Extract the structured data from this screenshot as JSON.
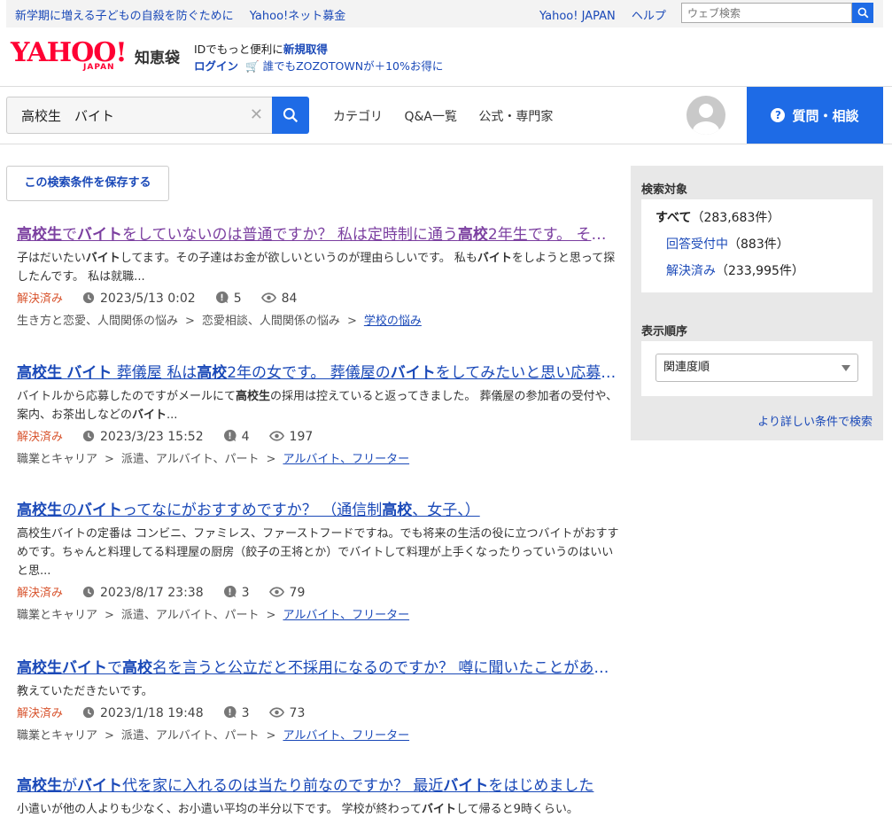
{
  "topbar": {
    "promo": [
      "新学期に増える子どもの自殺を防ぐために",
      "Yahoo!ネット募金"
    ],
    "links": [
      "Yahoo! JAPAN",
      "ヘルプ"
    ],
    "search_placeholder": "ウェブ検索"
  },
  "logo": {
    "yahoo": "YAHOO!",
    "japan": "JAPAN",
    "service": "知恵袋"
  },
  "account": {
    "line1_prefix": "IDでもっと便利に",
    "signup": "新規取得",
    "login": "ログイン",
    "zozo": "誰でもZOZOTOWNが＋10%お得に"
  },
  "search": {
    "query": "高校生　バイト"
  },
  "nav": [
    "カテゴリ",
    "Q&A一覧",
    "公式・専門家"
  ],
  "ask_button": "質問・相談",
  "save_button": "この検索条件を保存する",
  "results": [
    {
      "title_html": "<b>高校生</b>で<b>バイト</b>をしていないのは普通ですか？ 私は定時制に通う<b>高校</b>2年生です。 そして周りの子はみんなバイトしてます",
      "visited": true,
      "snippet_html": "子はだいたい<b>バイト</b>してます。その子達はお金が欲しいというのが理由らしいです。 私も<b>バイト</b>をしようと思って探したんです。 私は就職...",
      "status": "解決済み",
      "date": "2023/5/13 0:02",
      "answers": "5",
      "views": "84",
      "crumbs": [
        "生き方と恋愛、人間関係の悩み",
        "恋愛相談、人間関係の悩み",
        "学校の悩み"
      ]
    },
    {
      "title_html": "<b>高校生</b> <b>バイト</b> 葬儀屋 私は<b>高校</b>2年の女です。 葬儀屋の<b>バイト</b>をしてみたいと思い応募しました",
      "visited": false,
      "snippet_html": "バイトルから応募したのですがメールにて<b>高校生</b>の採用は控えていると返ってきました。 葬儀屋の参加者の受付や、案内、お茶出しなどの<b>バイト</b>...",
      "status": "解決済み",
      "date": "2023/3/23 15:52",
      "answers": "4",
      "views": "197",
      "crumbs": [
        "職業とキャリア",
        "派遣、アルバイト、パート",
        "アルバイト、フリーター"
      ]
    },
    {
      "title_html": "<b>高校生</b>の<b>バイト</b>ってなにがおすすめですか？ （通信制<b>高校</b>、女子、）",
      "visited": false,
      "snippet_html": "高校生バイトの定番は コンビニ、ファミレス、ファーストフードですね。でも将来の生活の役に立つバイトがおすすめです。ちゃんと料理してる料理屋の厨房（餃子の王将とか）でバイトして料理が上手くなったりっていうのはいいと思...",
      "status": "解決済み",
      "date": "2023/8/17 23:38",
      "answers": "3",
      "views": "79",
      "crumbs": [
        "職業とキャリア",
        "派遣、アルバイト、パート",
        "アルバイト、フリーター"
      ]
    },
    {
      "title_html": "<b>高校生バイト</b>で<b>高校</b>名を言うと公立だと不採用になるのですか？ 噂に聞いたことがあるのですが本当ですか",
      "visited": false,
      "snippet_html": "教えていただきたいです。",
      "status": "解決済み",
      "date": "2023/1/18 19:48",
      "answers": "3",
      "views": "73",
      "crumbs": [
        "職業とキャリア",
        "派遣、アルバイト、パート",
        "アルバイト、フリーター"
      ]
    },
    {
      "title_html": "<b>高校生</b>が<b>バイト</b>代を家に入れるのは当たり前なのですか？ 最近<b>バイト</b>をはじめました",
      "visited": false,
      "snippet_html": "小遣いが他の人よりも少なく、お小遣い平均の半分以下です。 学校が終わって<b>バイト</b>して帰ると9時くらい。",
      "status": "",
      "date": "",
      "answers": "",
      "views": "",
      "crumbs": []
    }
  ],
  "sidebar": {
    "target_heading": "検索対象",
    "targets": [
      {
        "label": "すべて",
        "count": "（283,683件）",
        "active": true
      },
      {
        "label": "回答受付中",
        "count": "（883件）",
        "active": false
      },
      {
        "label": "解決済み",
        "count": "（233,995件）",
        "active": false
      }
    ],
    "order_heading": "表示順序",
    "order_value": "関連度順",
    "more_link": "より詳しい条件で検索"
  }
}
